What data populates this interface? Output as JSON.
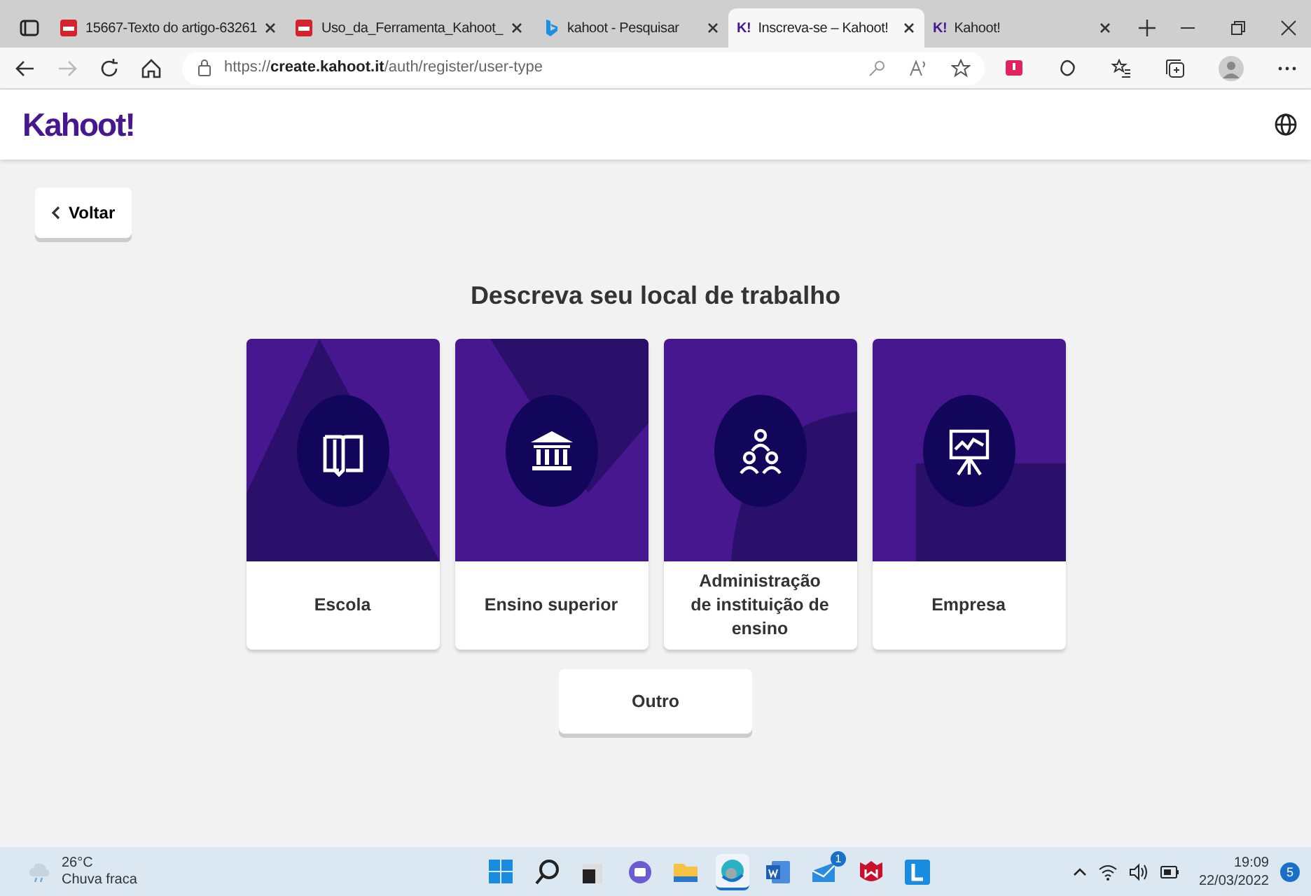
{
  "browser": {
    "tabs": [
      {
        "title": "15667-Texto do artigo-63261",
        "kind": "pdf",
        "selected": false
      },
      {
        "title": "Uso_da_Ferramenta_Kahoot_",
        "kind": "pdf",
        "selected": false
      },
      {
        "title": "kahoot - Pesquisar",
        "kind": "search",
        "selected": false
      },
      {
        "title": "Inscreva-se – Kahoot!",
        "kind": "site",
        "favicon": "K!",
        "selected": true
      },
      {
        "title": "Kahoot!",
        "kind": "site",
        "favicon": "K!",
        "selected": false
      }
    ],
    "url": "https://**create.kahoot.it**/auth/register/user-type"
  },
  "page": {
    "logo": "Kahoot!",
    "back_button": "Voltar",
    "heading": "Descreva seu local de trabalho",
    "options": [
      {
        "label": "Escola",
        "kind": "book"
      },
      {
        "label": "Ensino superior",
        "kind": "institution"
      },
      {
        "label": "Administração de instituição de ensino",
        "kind": "people"
      },
      {
        "label": "Empresa",
        "kind": "presentation"
      }
    ],
    "other_option": "Outro"
  },
  "taskbar": {
    "temperature": "26°C",
    "weather": "Chuva fraca",
    "apps": [
      {
        "kind": "start",
        "selected": false
      },
      {
        "kind": "search",
        "selected": false
      },
      {
        "kind": "widgets",
        "selected": false
      },
      {
        "kind": "chat",
        "selected": false
      },
      {
        "kind": "folder",
        "selected": false
      },
      {
        "kind": "browser",
        "selected": true
      },
      {
        "kind": "word",
        "selected": false
      },
      {
        "kind": "mail",
        "selected": false,
        "badge": "1"
      },
      {
        "kind": "shield",
        "selected": false
      },
      {
        "kind": "letter",
        "selected": false
      }
    ],
    "time": "19:09",
    "date": "22/03/2022",
    "notifications": "5"
  }
}
